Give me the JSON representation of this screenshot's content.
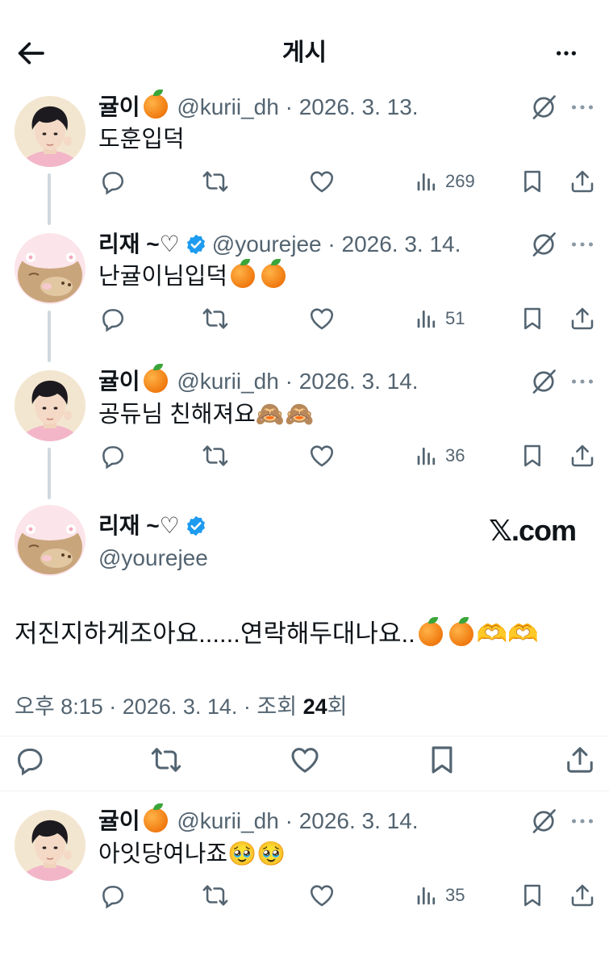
{
  "header": {
    "title": "게시"
  },
  "tweets": [
    {
      "name": "귤이",
      "handle": "@kurii_dh",
      "date": "2026. 3. 13.",
      "text": "도훈입덕",
      "views": "269"
    },
    {
      "name": "리재 ~♡",
      "handle": "@yourejee",
      "date": "2026. 3. 14.",
      "text": "난귤이님입덕",
      "views": "51"
    },
    {
      "name": "귤이",
      "handle": "@kurii_dh",
      "date": "2026. 3. 14.",
      "text": "공듀님 친해져요",
      "views": "36"
    },
    {
      "name": "귤이",
      "handle": "@kurii_dh",
      "date": "2026. 3. 14.",
      "text": "아잇당여나죠",
      "views": "35"
    }
  ],
  "main": {
    "name": "리재 ~♡",
    "handle": "@yourejee",
    "watermark": "𝕏.com",
    "text": "저진지하게조아요......연락해두대나요..",
    "time": "오후 8:15",
    "date": "2026. 3. 14.",
    "views_label": "조회",
    "views_count": "24",
    "views_suffix": "회"
  },
  "dot": "·",
  "icons": [
    "back-arrow-icon",
    "more-icon",
    "grok-icon",
    "reply-icon",
    "retweet-icon",
    "like-icon",
    "views-icon",
    "bookmark-icon",
    "share-icon",
    "verified-icon"
  ],
  "colors": {
    "text": "#0f1419",
    "secondary": "#536471",
    "verified": "#1d9bf0",
    "line": "#cfd9de"
  }
}
